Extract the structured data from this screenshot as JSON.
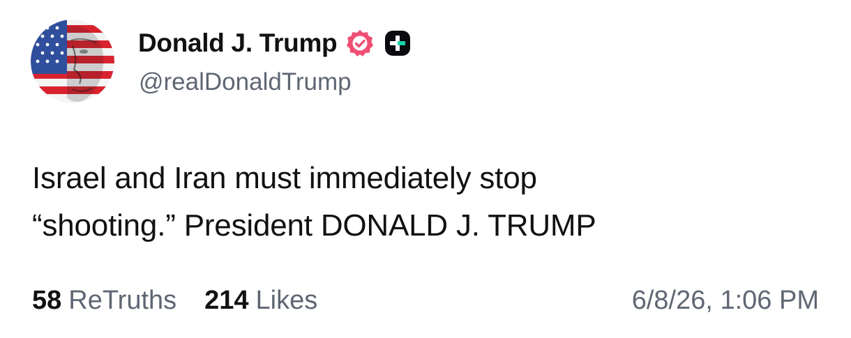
{
  "author": {
    "display_name": "Donald J. Trump",
    "handle": "@realDonaldTrump",
    "avatar_icon": "flag-portrait-avatar",
    "verified_icon": "verified-badge-icon",
    "verified_color": "#ef4f73",
    "plus_badge_icon": "plus-badge-icon"
  },
  "post": {
    "lines": [
      "Israel and Iran must immediately stop",
      "“shooting.” President DONALD J. TRUMP"
    ]
  },
  "stats": {
    "retruths_count": "58",
    "retruths_label": "ReTruths",
    "likes_count": "214",
    "likes_label": "Likes"
  },
  "timestamp": "6/8/26, 1:06 PM"
}
